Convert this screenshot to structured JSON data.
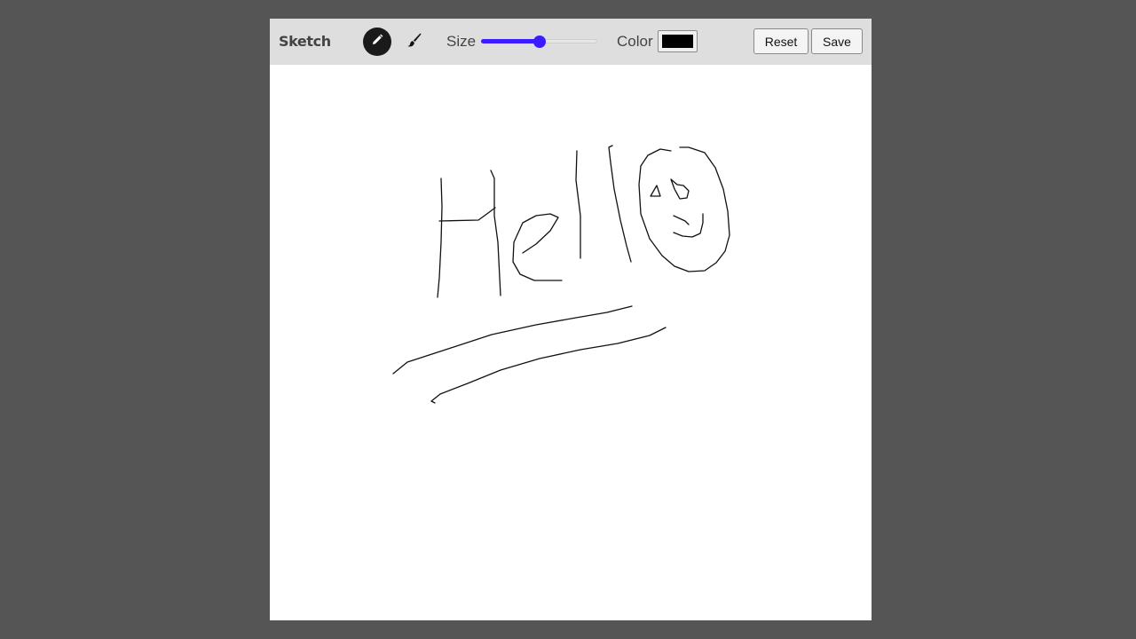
{
  "app": {
    "title": "Sketch"
  },
  "tools": [
    {
      "name": "pencil",
      "icon": "pencil-icon",
      "active": true
    },
    {
      "name": "brush",
      "icon": "brush-icon",
      "active": false
    }
  ],
  "size": {
    "label": "Size",
    "value_fraction": 0.5
  },
  "color": {
    "label": "Color",
    "value": "#000000"
  },
  "buttons": {
    "reset_label": "Reset",
    "save_label": "Save"
  },
  "colors": {
    "background": "#555555",
    "toolbar": "#dedede",
    "slider_accent": "#3a1cff",
    "active_tool": "#1a1a1a"
  }
}
